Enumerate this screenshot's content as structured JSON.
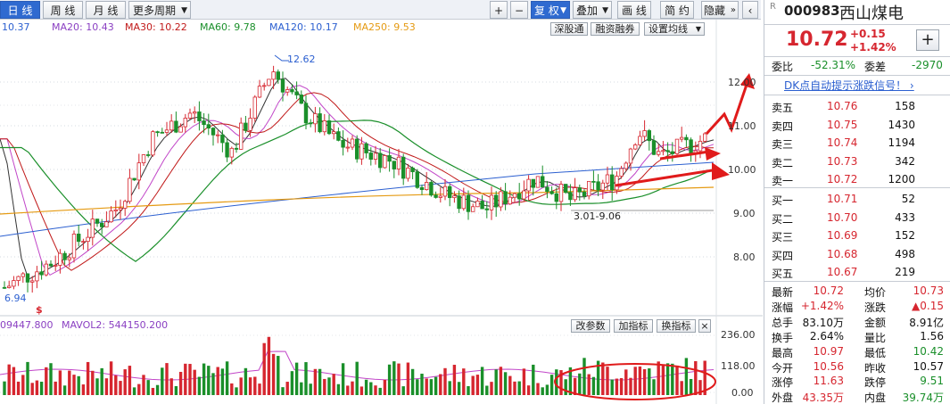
{
  "toolbar": {
    "tabs": [
      "日 线",
      "周 线",
      "月 线",
      "更多周期"
    ],
    "buttons": {
      "plus": "+",
      "minus": "−",
      "fuquan": "复 权",
      "diejia": "叠加",
      "huaxian": "画 线",
      "jianyue": "简 约",
      "yincang": "隐藏"
    }
  },
  "ma_legend": [
    {
      "text": "10.37",
      "color": "#2b5fd0"
    },
    {
      "text": "MA20: 10.43",
      "color": "#8a3fc2"
    },
    {
      "text": "MA30: 10.22",
      "color": "#c01818"
    },
    {
      "text": "MA60: 9.78",
      "color": "#1a8f2a"
    },
    {
      "text": "MA120: 10.17",
      "color": "#2b5fd0"
    },
    {
      "text": "MA250: 9.53",
      "color": "#e59a12"
    }
  ],
  "chart_buttons": {
    "shengu": "深股通",
    "rongzi": "融资融券",
    "shezhi": "设置均线",
    "gaicanshu": "改参数",
    "jiazhibiao": "加指标",
    "huanzhibiao": "换指标",
    "close": "×"
  },
  "price_axis": [
    "12.00",
    "11.00",
    "10.00",
    "9.00",
    "8.00"
  ],
  "vol_axis": [
    "236.00",
    "118.00",
    "0.00"
  ],
  "annotations": {
    "high": "12.62",
    "low": "6.94",
    "range": "3.01-9.06",
    "dollar": "$"
  },
  "volume_legend": {
    "left": "09447.800",
    "mavol": "MAVOL2: 544150.200"
  },
  "quote": {
    "rmark": "R",
    "code": "000983",
    "name": "西山煤电",
    "price": "10.72",
    "change": "+0.15",
    "change_pct": "+1.42%",
    "plus": "+",
    "weibi_label": "委比",
    "weibi": "-52.31%",
    "weicha_label": "委差",
    "weicha": "-2970",
    "signal": "DK点自动提示涨跌信号！ ›",
    "asks": [
      {
        "label": "卖五",
        "price": "10.76",
        "vol": "158"
      },
      {
        "label": "卖四",
        "price": "10.75",
        "vol": "1430"
      },
      {
        "label": "卖三",
        "price": "10.74",
        "vol": "1194"
      },
      {
        "label": "卖二",
        "price": "10.73",
        "vol": "342"
      },
      {
        "label": "卖一",
        "price": "10.72",
        "vol": "1200"
      }
    ],
    "bids": [
      {
        "label": "买一",
        "price": "10.71",
        "vol": "52"
      },
      {
        "label": "买二",
        "price": "10.70",
        "vol": "433"
      },
      {
        "label": "买三",
        "price": "10.69",
        "vol": "152"
      },
      {
        "label": "买四",
        "price": "10.68",
        "vol": "498"
      },
      {
        "label": "买五",
        "price": "10.67",
        "vol": "219"
      }
    ],
    "stats": [
      {
        "l1": "最新",
        "v1": "10.72",
        "c1": "red",
        "l2": "均价",
        "v2": "10.73",
        "c2": "red"
      },
      {
        "l1": "涨幅",
        "v1": "+1.42%",
        "c1": "red",
        "l2": "涨跌",
        "v2": "▲0.15",
        "c2": "red"
      },
      {
        "l1": "总手",
        "v1": "83.10万",
        "c1": "blk",
        "l2": "金额",
        "v2": "8.91亿",
        "c2": "blk"
      },
      {
        "l1": "换手",
        "v1": "2.64%",
        "c1": "blk",
        "l2": "量比",
        "v2": "1.56",
        "c2": "blk"
      },
      {
        "l1": "最高",
        "v1": "10.97",
        "c1": "red",
        "l2": "最低",
        "v2": "10.42",
        "c2": "green"
      },
      {
        "l1": "今开",
        "v1": "10.56",
        "c1": "red",
        "l2": "昨收",
        "v2": "10.57",
        "c2": "blk"
      },
      {
        "l1": "涨停",
        "v1": "11.63",
        "c1": "red",
        "l2": "跌停",
        "v2": "9.51",
        "c2": "green"
      },
      {
        "l1": "外盘",
        "v1": "43.35万",
        "c1": "red",
        "l2": "内盘",
        "v2": "39.74万",
        "c2": "green"
      }
    ]
  }
}
